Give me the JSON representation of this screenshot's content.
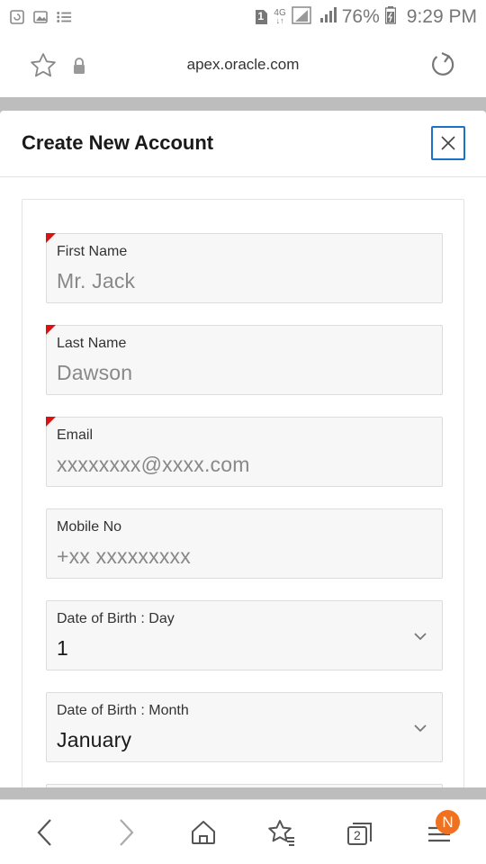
{
  "status_bar": {
    "network": "4G",
    "battery": "76%",
    "time": "9:29 PM",
    "sim_badge": "1",
    "icons": [
      "screenshot-icon",
      "gallery-icon",
      "list-icon",
      "sim-icon",
      "network-4g-icon",
      "signal-icon",
      "battery-icon"
    ]
  },
  "browser": {
    "url": "apex.oracle.com",
    "tab_count": "2",
    "notification_badge": "N"
  },
  "dialog": {
    "title": "Create New Account",
    "close_label": "Close"
  },
  "form": {
    "first_name": {
      "label": "First Name",
      "placeholder": "Mr. Jack",
      "required": true
    },
    "last_name": {
      "label": "Last Name",
      "placeholder": "Dawson",
      "required": true
    },
    "email": {
      "label": "Email",
      "placeholder": "xxxxxxxx@xxxx.com",
      "required": true
    },
    "mobile": {
      "label": "Mobile No",
      "placeholder": "+xx xxxxxxxxx",
      "required": false
    },
    "dob_day": {
      "label": "Date of Birth : Day",
      "value": "1"
    },
    "dob_month": {
      "label": "Date of Birth : Month",
      "value": "January"
    }
  },
  "colors": {
    "accent": "#1a73c8",
    "required_marker": "#dd1111",
    "badge": "#f0711f",
    "backdrop": "#bdbdbd"
  }
}
